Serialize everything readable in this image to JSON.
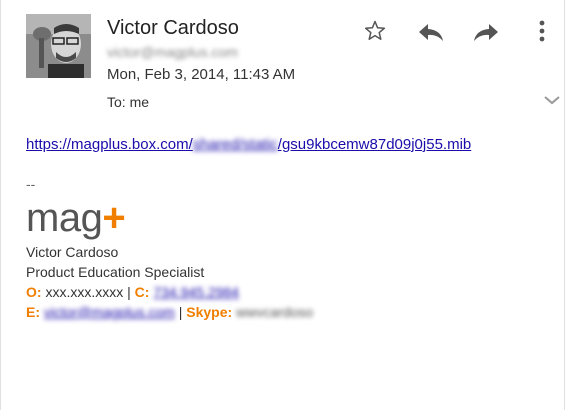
{
  "header": {
    "sender_name": "Victor Cardoso",
    "sender_email": "victor@magplus.com",
    "timestamp": "Mon, Feb 3, 2014, 11:43 AM",
    "to_line": "To: me"
  },
  "icons": {
    "star": "star-icon",
    "reply": "reply-icon",
    "forward": "forward-icon",
    "more": "more-vertical-icon",
    "expand": "chevron-down-icon"
  },
  "body": {
    "link_prefix": "https://magplus.box.com/",
    "link_hidden": "shared/static",
    "link_suffix": "/gsu9kbcemw87d09j0j55.mib"
  },
  "signature": {
    "dash": "--",
    "logo_text": "mag",
    "logo_plus": "+",
    "name": "Victor Cardoso",
    "title": "Product Education Specialist",
    "office_label": "O:",
    "office_value": "xxx.xxx.xxxx",
    "separator": "|",
    "cell_label": "C:",
    "cell_value": "734.945.2984",
    "email_label": "E:",
    "email_value": "victor@magplus.com",
    "skype_label": "Skype:",
    "skype_value": "wwvcardoso"
  },
  "colors": {
    "accent_orange": "#f07f00",
    "link_blue": "#1a0dab"
  }
}
